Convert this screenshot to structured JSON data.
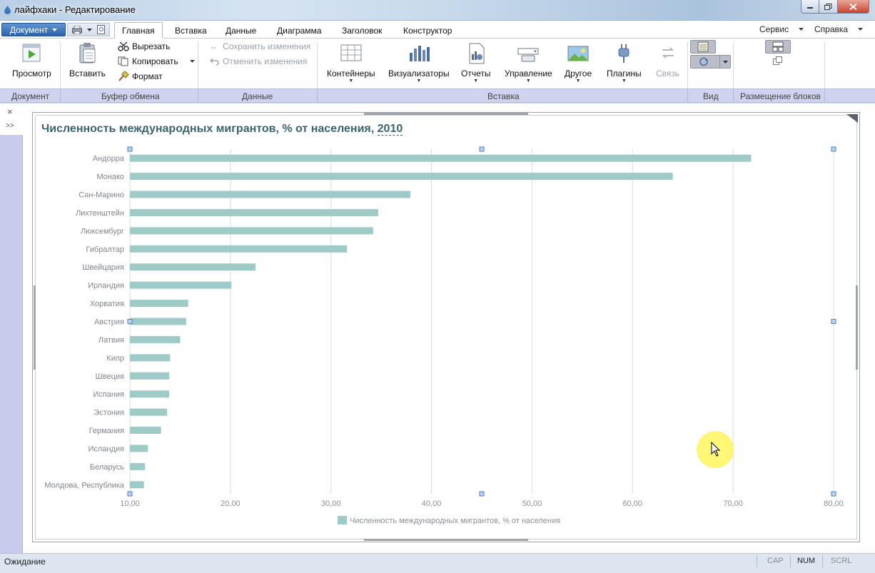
{
  "window": {
    "title": "лайфхаки - Редактирование",
    "app_icon": "drop-icon",
    "controls": [
      "minimize-icon",
      "maximize-icon",
      "close-icon"
    ]
  },
  "menubar": {
    "document_button": "Документ",
    "quick_access": [
      "print-icon",
      "dropdown-icon",
      "preview-icon"
    ],
    "tabs": [
      {
        "label": "Главная",
        "active": true
      },
      {
        "label": "Вставка",
        "active": false
      },
      {
        "label": "Данные",
        "active": false
      },
      {
        "label": "Диаграмма",
        "active": false
      },
      {
        "label": "Заголовок",
        "active": false
      },
      {
        "label": "Конструктор",
        "active": false
      }
    ],
    "right_menus": [
      "Сервис",
      "Справка"
    ]
  },
  "ribbon": {
    "document": {
      "preview": "Просмотр"
    },
    "clipboard": {
      "paste": "Вставить",
      "cut": "Вырезать",
      "copy": "Копировать",
      "format": "Формат"
    },
    "data": {
      "save_changes": "Сохранить изменения",
      "undo_changes": "Отменить изменения"
    },
    "insert": {
      "containers": "Контейнеры",
      "visualizers": "Визуализаторы",
      "reports": "Отчеты",
      "controls": "Управление",
      "other": "Другое",
      "plugins": "Плагины",
      "link": "Связь"
    },
    "groups": [
      "Документ",
      "Буфер обмена",
      "Данные",
      "Вставка",
      "Вид",
      "Размещение блоков"
    ]
  },
  "chart_data": {
    "type": "bar",
    "orientation": "horizontal",
    "title": "Численность международных мигрантов, % от населения, ",
    "title_year": "2010",
    "categories": [
      "Андорра",
      "Монако",
      "Сан-Марино",
      "Лихтенштейн",
      "Люксембург",
      "Гибралтар",
      "Швейцария",
      "Ирландия",
      "Хорватия",
      "Австрия",
      "Латвия",
      "Кипр",
      "Швеция",
      "Испания",
      "Эстония",
      "Германия",
      "Исландия",
      "Беларусь",
      "Молдова, Республика"
    ],
    "values": [
      71.8,
      64.0,
      37.9,
      34.7,
      34.2,
      31.6,
      22.5,
      20.1,
      15.8,
      15.6,
      15.0,
      14.0,
      13.9,
      13.9,
      13.7,
      13.1,
      11.8,
      11.5,
      11.4
    ],
    "xlim": [
      10,
      80
    ],
    "ticks": [
      "10,00",
      "20,00",
      "30,00",
      "40,00",
      "50,00",
      "60,00",
      "70,00",
      "80,00"
    ],
    "legend": "Численность международных мигрантов, % от населения",
    "legend_position": "bottom",
    "grid": true,
    "bar_color": "#9ecbc8"
  },
  "statusbar": {
    "status": "Ожидание",
    "indicators": [
      {
        "label": "CAP",
        "on": false
      },
      {
        "label": "NUM",
        "on": true
      },
      {
        "label": "SCRL",
        "on": false
      }
    ]
  },
  "sidepanel": {
    "close": "×",
    "expand": ">>"
  }
}
